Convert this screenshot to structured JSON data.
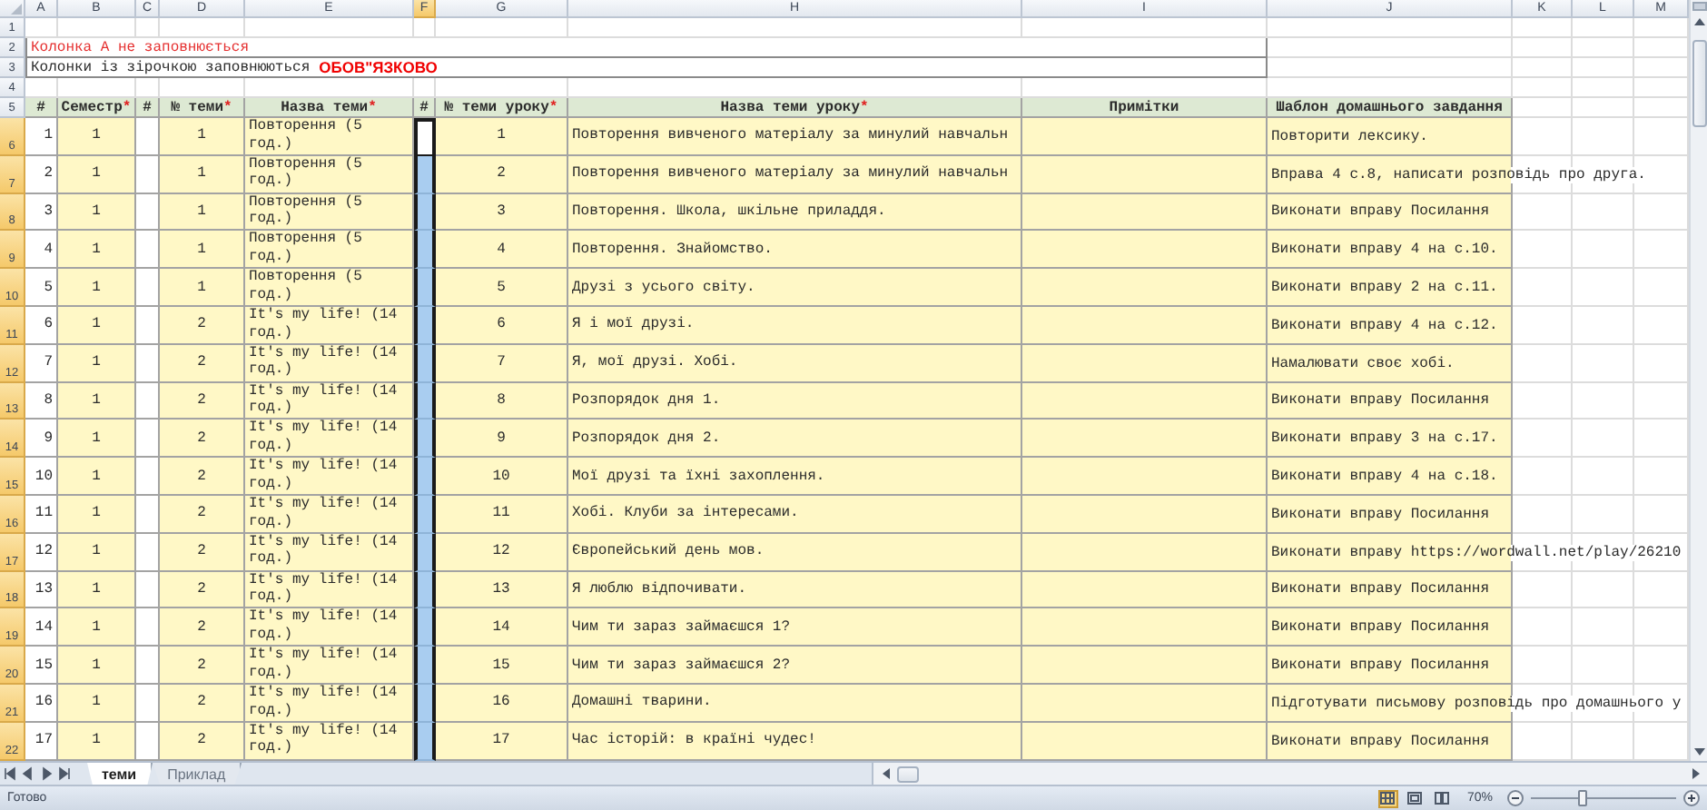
{
  "column_headers": [
    {
      "label": "A",
      "selected": false
    },
    {
      "label": "B",
      "selected": false
    },
    {
      "label": "C",
      "selected": false
    },
    {
      "label": "D",
      "selected": false
    },
    {
      "label": "E",
      "selected": false
    },
    {
      "label": "F",
      "selected": true
    },
    {
      "label": "G",
      "selected": false
    },
    {
      "label": "H",
      "selected": false
    },
    {
      "label": "I",
      "selected": false
    },
    {
      "label": "J",
      "selected": false
    },
    {
      "label": "K",
      "selected": false
    },
    {
      "label": "L",
      "selected": false
    },
    {
      "label": "M",
      "selected": false
    }
  ],
  "row_headers": [
    {
      "label": "1",
      "selected": false
    },
    {
      "label": "2",
      "selected": false
    },
    {
      "label": "3",
      "selected": false
    },
    {
      "label": "4",
      "selected": false
    },
    {
      "label": "5",
      "selected": false
    },
    {
      "label": "6",
      "selected": true
    },
    {
      "label": "7",
      "selected": true
    },
    {
      "label": "8",
      "selected": true
    },
    {
      "label": "9",
      "selected": true
    },
    {
      "label": "10",
      "selected": true
    },
    {
      "label": "11",
      "selected": true
    },
    {
      "label": "12",
      "selected": true
    },
    {
      "label": "13",
      "selected": true
    },
    {
      "label": "14",
      "selected": true
    },
    {
      "label": "15",
      "selected": true
    },
    {
      "label": "16",
      "selected": true
    },
    {
      "label": "17",
      "selected": true
    },
    {
      "label": "18",
      "selected": true
    },
    {
      "label": "19",
      "selected": true
    },
    {
      "label": "20",
      "selected": true
    },
    {
      "label": "21",
      "selected": true
    },
    {
      "label": "22",
      "selected": true
    }
  ],
  "notes": {
    "line_1": "Колонка А не заповнюється",
    "line_2": "Колонки із зірочкою заповнюються",
    "line_2_emphasis": "ОБОВ\"ЯЗКОВО"
  },
  "table": {
    "columns": [
      {
        "label": "#"
      },
      {
        "label": "Семестр",
        "required_mark": "*"
      },
      {
        "label": "#"
      },
      {
        "label": "№ теми",
        "required_mark": "*"
      },
      {
        "label": "Назва теми",
        "required_mark": "*"
      },
      {
        "label": "#"
      },
      {
        "label": "№ теми уроку",
        "required_mark": "*"
      },
      {
        "label": "Назва теми уроку",
        "required_mark": "*"
      },
      {
        "label": "Примітки"
      },
      {
        "label": "Шаблон домашнього завдання"
      }
    ],
    "rows": [
      {
        "number": "1",
        "semester": "1",
        "topic_no": "1",
        "topic": "Повторення (5 год.)",
        "lesson_no": "1",
        "lesson": "Повторення вивченого матеріалу за минулий навчальн",
        "homework": "Повторити лексику.",
        "active": true
      },
      {
        "number": "2",
        "semester": "1",
        "topic_no": "1",
        "topic": "Повторення (5 год.)",
        "lesson_no": "2",
        "lesson": "Повторення вивченого матеріалу за минулий навчальн",
        "homework": "Вправа 4 с.8, написати розповідь про друга.",
        "active": false
      },
      {
        "number": "3",
        "semester": "1",
        "topic_no": "1",
        "topic": "Повторення (5 год.)",
        "lesson_no": "3",
        "lesson": "Повторення. Школа, шкільне приладдя.",
        "homework": "Виконати вправу Посилання",
        "active": false
      },
      {
        "number": "4",
        "semester": "1",
        "topic_no": "1",
        "topic": "Повторення (5 год.)",
        "lesson_no": "4",
        "lesson": "Повторення. Знайомство.",
        "homework": "Виконати вправу 4 на с.10.",
        "active": false
      },
      {
        "number": "5",
        "semester": "1",
        "topic_no": "1",
        "topic": "Повторення (5 год.)",
        "lesson_no": "5",
        "lesson": "Друзі з усього світу.",
        "homework": "Виконати вправу 2 на с.11.",
        "active": false
      },
      {
        "number": "6",
        "semester": "1",
        "topic_no": "2",
        "topic": "It's my life! (14 год.)",
        "lesson_no": "6",
        "lesson": "Я і мої друзі.",
        "homework": "Виконати вправу 4 на с.12.",
        "active": false
      },
      {
        "number": "7",
        "semester": "1",
        "topic_no": "2",
        "topic": "It's my life! (14 год.)",
        "lesson_no": "7",
        "lesson": "Я, мої друзі. Хобі.",
        "homework": "Намалювати своє хобі.",
        "active": false
      },
      {
        "number": "8",
        "semester": "1",
        "topic_no": "2",
        "topic": "It's my life! (14 год.)",
        "lesson_no": "8",
        "lesson": "Розпорядок дня 1.",
        "homework": "Виконати вправу Посилання",
        "active": false
      },
      {
        "number": "9",
        "semester": "1",
        "topic_no": "2",
        "topic": "It's my life! (14 год.)",
        "lesson_no": "9",
        "lesson": "Розпорядок дня 2.",
        "homework": "Виконати вправу 3 на с.17.",
        "active": false
      },
      {
        "number": "10",
        "semester": "1",
        "topic_no": "2",
        "topic": "It's my life! (14 год.)",
        "lesson_no": "10",
        "lesson": "Мої друзі та їхні захоплення.",
        "homework": "Виконати вправу 4 на с.18.",
        "active": false
      },
      {
        "number": "11",
        "semester": "1",
        "topic_no": "2",
        "topic": "It's my life! (14 год.)",
        "lesson_no": "11",
        "lesson": "Хобі. Клуби за інтересами.",
        "homework": "Виконати вправу Посилання",
        "active": false
      },
      {
        "number": "12",
        "semester": "1",
        "topic_no": "2",
        "topic": "It's my life! (14 год.)",
        "lesson_no": "12",
        "lesson": "Європейський день мов.",
        "homework": "Виконати вправу https://wordwall.net/play/26210",
        "active": false
      },
      {
        "number": "13",
        "semester": "1",
        "topic_no": "2",
        "topic": "It's my life! (14 год.)",
        "lesson_no": "13",
        "lesson": "Я люблю відпочивати.",
        "homework": "Виконати вправу Посилання",
        "active": false
      },
      {
        "number": "14",
        "semester": "1",
        "topic_no": "2",
        "topic": "It's my life! (14 год.)",
        "lesson_no": "14",
        "lesson": "Чим ти зараз займаєшся 1?",
        "homework": "Виконати вправу Посилання",
        "active": false
      },
      {
        "number": "15",
        "semester": "1",
        "topic_no": "2",
        "topic": "It's my life! (14 год.)",
        "lesson_no": "15",
        "lesson": "Чим ти зараз займаєшся 2?",
        "homework": "Виконати вправу Посилання",
        "active": false
      },
      {
        "number": "16",
        "semester": "1",
        "topic_no": "2",
        "topic": "It's my life! (14 год.)",
        "lesson_no": "16",
        "lesson": "Домашні тварини.",
        "homework": "Підготувати письмову розповідь про домашнього у",
        "active": false
      },
      {
        "number": "17",
        "semester": "1",
        "topic_no": "2",
        "topic": "It's my life! (14 год.)",
        "lesson_no": "17",
        "lesson": "Час історій: в країні чудес!",
        "homework": "Виконати вправу Посилання",
        "active": false
      }
    ]
  },
  "sheet_tabs": [
    {
      "label": "теми",
      "selected": true
    },
    {
      "label": "Приклад",
      "selected": false
    }
  ],
  "status_bar": {
    "text": "Готово",
    "view_buttons": [
      {
        "kind": "normal",
        "selected": true
      },
      {
        "kind": "page_layout",
        "selected": false
      },
      {
        "kind": "page_break",
        "selected": false
      }
    ],
    "zoom": "70%",
    "zoom_slider": {
      "level": 0.35
    }
  }
}
